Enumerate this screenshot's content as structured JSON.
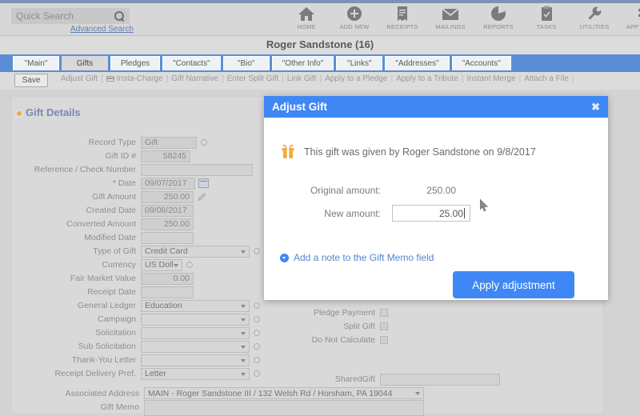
{
  "header": {
    "search": {
      "placeholder": "Quick Search",
      "icon": "search-icon"
    },
    "advanced_search": "Advanced Search",
    "toolbar": [
      {
        "label": "HOME",
        "icon": "home-icon"
      },
      {
        "label": "ADD NEW",
        "icon": "plus-circle-icon"
      },
      {
        "label": "RECEIPTS",
        "icon": "receipt-icon"
      },
      {
        "label": "MAILINGS",
        "icon": "envelope-icon"
      },
      {
        "label": "REPORTS",
        "icon": "pie-chart-icon"
      },
      {
        "label": "TASKS",
        "icon": "clipboard-icon"
      },
      {
        "label": "UTILITIES",
        "icon": "wrench-icon"
      },
      {
        "label": "APP LINKS",
        "icon": "puzzle-icon"
      }
    ]
  },
  "record": {
    "title": "Roger Sandstone  (16)"
  },
  "tabs": [
    {
      "label": "\"Main\"",
      "active": false
    },
    {
      "label": "Gifts",
      "active": true
    },
    {
      "label": "Pledges",
      "active": false
    },
    {
      "label": "\"Contacts\"",
      "active": false
    },
    {
      "label": "\"Bio\"",
      "active": false
    },
    {
      "label": "\"Other Info\"",
      "active": false
    },
    {
      "label": "\"Links\"",
      "active": false
    },
    {
      "label": "\"Addresses\"",
      "active": false
    },
    {
      "label": "\"Accounts\"",
      "active": false
    }
  ],
  "actionbar": {
    "save_label": "Save",
    "links": [
      "Adjust Gift",
      "Insta-Charge",
      "Gift Narrative",
      "Enter Split Gift",
      "Link Gift",
      "Apply to a Pledge",
      "Apply to a Tribute",
      "Instant Merge",
      "Attach a File"
    ]
  },
  "panel": {
    "title": "Gift Details",
    "left_fields": [
      {
        "label": "Record Type",
        "value": "Gift",
        "type": "text",
        "w": 70,
        "extra": "circle"
      },
      {
        "label": "Gift ID #",
        "value": "58245",
        "type": "number",
        "w": 62
      },
      {
        "label": "Reference / Check Number",
        "value": "",
        "type": "text",
        "w": 140
      },
      {
        "label": "* Date",
        "value": "09/07/2017",
        "type": "date",
        "w": 68,
        "extra": "calendar"
      },
      {
        "label": "Gift Amount",
        "value": "250.00",
        "type": "number",
        "w": 66,
        "extra": "pencil"
      },
      {
        "label": "Created Date",
        "value": "09/08/2017",
        "type": "text",
        "w": 66
      },
      {
        "label": "Converted Amount",
        "value": "250.00",
        "type": "number",
        "w": 66
      },
      {
        "label": "Modified Date",
        "value": "",
        "type": "text",
        "w": 66
      },
      {
        "label": "Type of Gift",
        "value": "Credit Card",
        "type": "select",
        "w": 136,
        "extra": "circle"
      },
      {
        "label": "Currency",
        "value": "US Doll",
        "type": "select",
        "w": 52,
        "extra": "circle"
      },
      {
        "label": "Fair Market Value",
        "value": "0.00",
        "type": "number",
        "w": 66
      },
      {
        "label": "Receipt Date",
        "value": "",
        "type": "text",
        "w": 66
      },
      {
        "label": "General Ledger",
        "value": "Education",
        "type": "select",
        "w": 136,
        "extra": "circle"
      },
      {
        "label": "Campaign",
        "value": "",
        "type": "select",
        "w": 136,
        "extra": "circle"
      },
      {
        "label": "Solicitation",
        "value": "",
        "type": "select",
        "w": 136,
        "extra": "circle"
      },
      {
        "label": "Sub Solicitation",
        "value": "",
        "type": "select",
        "w": 136,
        "extra": "circle"
      },
      {
        "label": "Thank-You Letter",
        "value": "",
        "type": "select",
        "w": 136,
        "extra": "circle"
      },
      {
        "label": "Receipt Delivery Pref.",
        "value": "Letter",
        "type": "select",
        "w": 136,
        "extra": "circle"
      }
    ],
    "associated_address": {
      "label": "Associated Address",
      "value": "MAIN - Roger Sandstone III / 132 Welsh Rd / Horsham, PA 19044"
    },
    "gift_memo": {
      "label": "Gift Memo",
      "value": ""
    },
    "right_fields": [
      {
        "label": "Pledge Payment",
        "type": "checkbox",
        "checked": false
      },
      {
        "label": "Split Gift",
        "type": "checkbox",
        "checked": false
      },
      {
        "label": "Do Not Calculate",
        "type": "checkbox",
        "checked": false
      },
      {
        "label": "SharedGift",
        "type": "text",
        "value": ""
      }
    ]
  },
  "modal": {
    "title": "Adjust Gift",
    "close_label": "✖",
    "gift_icon": "gift-icon",
    "message": "This gift was given by Roger Sandstone on 9/8/2017",
    "original_label": "Original amount:",
    "original_value": "250.00",
    "new_label": "New amount:",
    "new_value": "25.00",
    "note_link": "Add a note to the Gift Memo field",
    "apply_label": "Apply adjustment"
  },
  "colors": {
    "accent_blue": "#3f87f5",
    "tabstrip_blue": "#5b8dd6",
    "panel_title": "#7b88b5",
    "gift_orange": "#f0a848",
    "link_blue": "#5a83c9"
  }
}
